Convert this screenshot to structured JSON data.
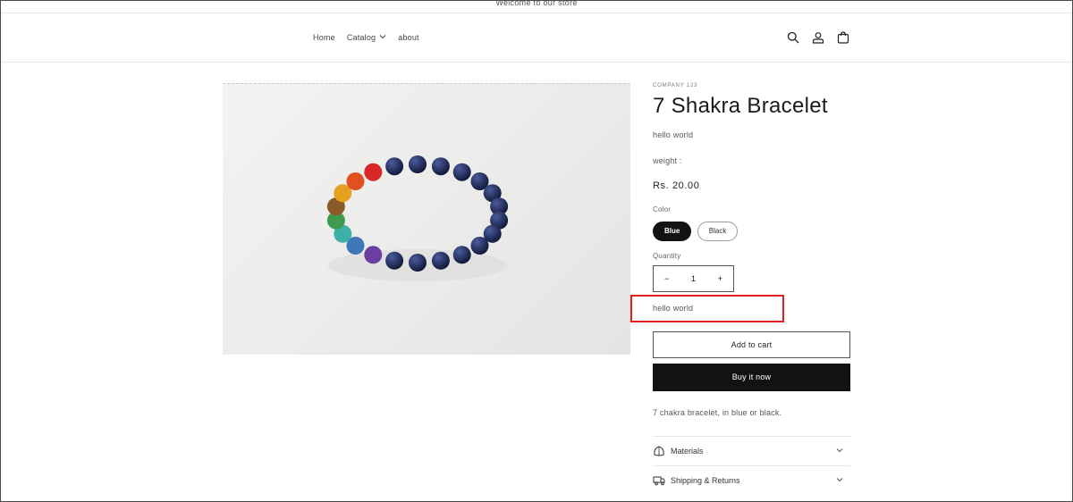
{
  "announcement": "Welcome to our store",
  "nav": {
    "items": [
      {
        "label": "Home"
      },
      {
        "label": "Catalog",
        "has_dropdown": true
      },
      {
        "label": "about"
      }
    ]
  },
  "header_icons": [
    "search-icon",
    "account-icon",
    "cart-icon"
  ],
  "product": {
    "vendor": "COMPANY 123",
    "title": "7 Shakra Bracelet",
    "subtitle": "hello world",
    "weight_label": "weight :",
    "price": "Rs. 20.00",
    "color_label": "Color",
    "color_options": [
      "Blue",
      "Black"
    ],
    "color_selected": "Blue",
    "quantity_label": "Quantity",
    "quantity_value": "1",
    "quantity_minus": "−",
    "quantity_plus": "+",
    "highlight_text": "hello world",
    "add_to_cart": "Add to cart",
    "buy_now": "Buy it now",
    "description": "7 chakra bracelet, in blue or black.",
    "accordions": [
      {
        "label": "Materials",
        "icon": "leaf-icon"
      },
      {
        "label": "Shipping & Returns",
        "icon": "truck-icon"
      }
    ]
  },
  "colors": {
    "highlight_border": "#e02020",
    "button_dark": "#121212"
  }
}
